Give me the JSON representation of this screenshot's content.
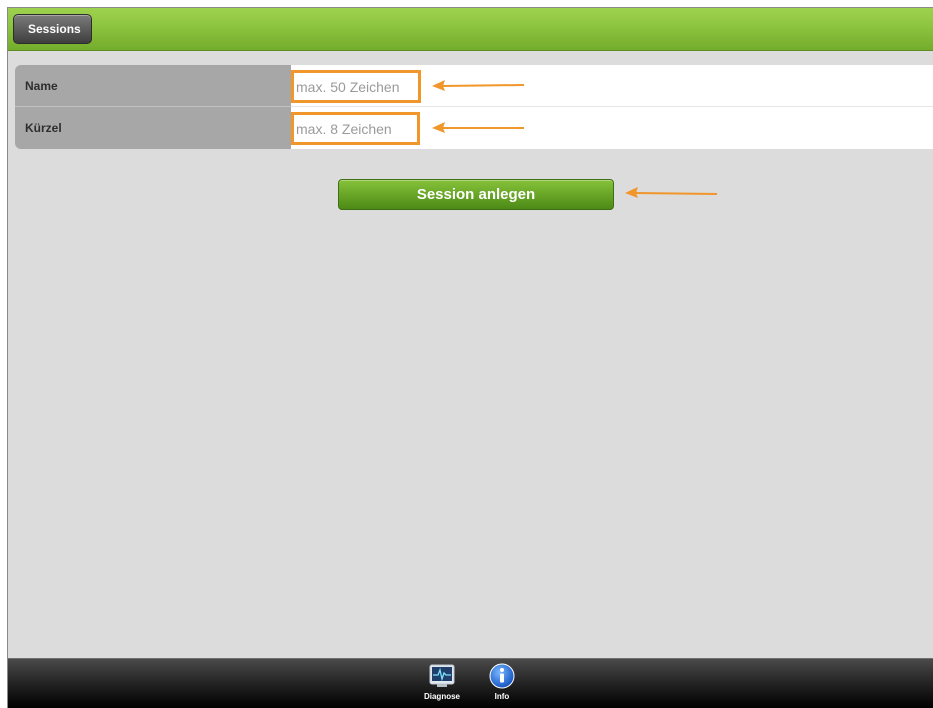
{
  "header": {
    "back_label": "Sessions"
  },
  "form": {
    "name_label": "Name",
    "name_placeholder": "max. 50 Zeichen",
    "kuerzel_label": "Kürzel",
    "kuerzel_placeholder": "max. 8 Zeichen"
  },
  "actions": {
    "create_label": "Session anlegen"
  },
  "toolbar": {
    "items": [
      {
        "label": "Diagnose",
        "icon": "monitor-pulse-icon"
      },
      {
        "label": "Info",
        "icon": "info-icon"
      }
    ]
  },
  "colors": {
    "header_green": "#8cc43f",
    "highlight_orange": "#f0962a",
    "button_green": "#5a9a1e"
  }
}
